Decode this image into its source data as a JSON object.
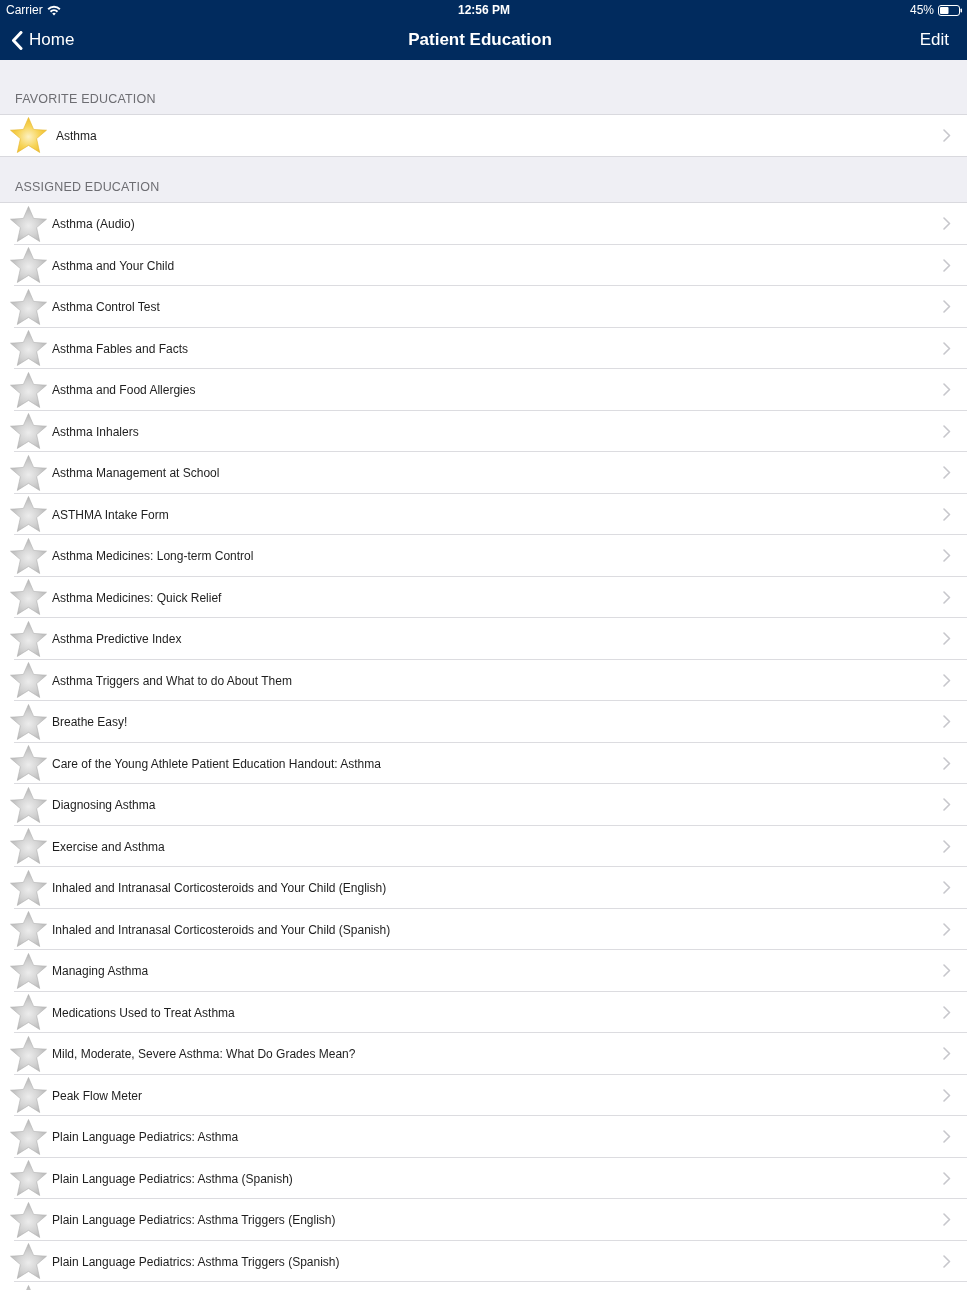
{
  "status_bar": {
    "carrier": "Carrier",
    "time": "12:56 PM",
    "battery": "45%"
  },
  "nav_bar": {
    "back": "Home",
    "title": "Patient Education",
    "action": "Edit"
  },
  "sections": [
    {
      "header": "FAVORITE EDUCATION",
      "items": [
        {
          "title": "Asthma",
          "favorite": true
        }
      ]
    },
    {
      "header": "ASSIGNED EDUCATION",
      "items": [
        {
          "title": "Asthma (Audio)",
          "favorite": false
        },
        {
          "title": "Asthma and Your Child",
          "favorite": false
        },
        {
          "title": "Asthma Control Test",
          "favorite": false
        },
        {
          "title": "Asthma Fables and Facts",
          "favorite": false
        },
        {
          "title": "Asthma and Food Allergies",
          "favorite": false
        },
        {
          "title": "Asthma Inhalers",
          "favorite": false
        },
        {
          "title": "Asthma Management at School",
          "favorite": false
        },
        {
          "title": "ASTHMA Intake Form",
          "favorite": false
        },
        {
          "title": "Asthma Medicines: Long-term Control",
          "favorite": false
        },
        {
          "title": "Asthma Medicines: Quick Relief",
          "favorite": false
        },
        {
          "title": "Asthma Predictive Index",
          "favorite": false
        },
        {
          "title": "Asthma Triggers and What to do About Them",
          "favorite": false
        },
        {
          "title": "Breathe Easy!",
          "favorite": false
        },
        {
          "title": "Care of the Young Athlete Patient Education Handout: Asthma",
          "favorite": false
        },
        {
          "title": "Diagnosing Asthma",
          "favorite": false
        },
        {
          "title": "Exercise and Asthma",
          "favorite": false
        },
        {
          "title": "Inhaled and Intranasal Corticosteroids and Your Child (English)",
          "favorite": false
        },
        {
          "title": "Inhaled and Intranasal Corticosteroids and Your Child (Spanish)",
          "favorite": false
        },
        {
          "title": "Managing Asthma",
          "favorite": false
        },
        {
          "title": "Medications Used to Treat Asthma",
          "favorite": false
        },
        {
          "title": "Mild, Moderate, Severe Asthma: What Do Grades Mean?",
          "favorite": false
        },
        {
          "title": "Peak Flow Meter",
          "favorite": false
        },
        {
          "title": "Plain Language Pediatrics: Asthma",
          "favorite": false
        },
        {
          "title": "Plain Language Pediatrics: Asthma (Spanish)",
          "favorite": false
        },
        {
          "title": "Plain Language Pediatrics: Asthma Triggers (English)",
          "favorite": false
        },
        {
          "title": "Plain Language Pediatrics: Asthma Triggers (Spanish)",
          "favorite": false
        },
        {
          "favorite": false
        }
      ]
    }
  ]
}
